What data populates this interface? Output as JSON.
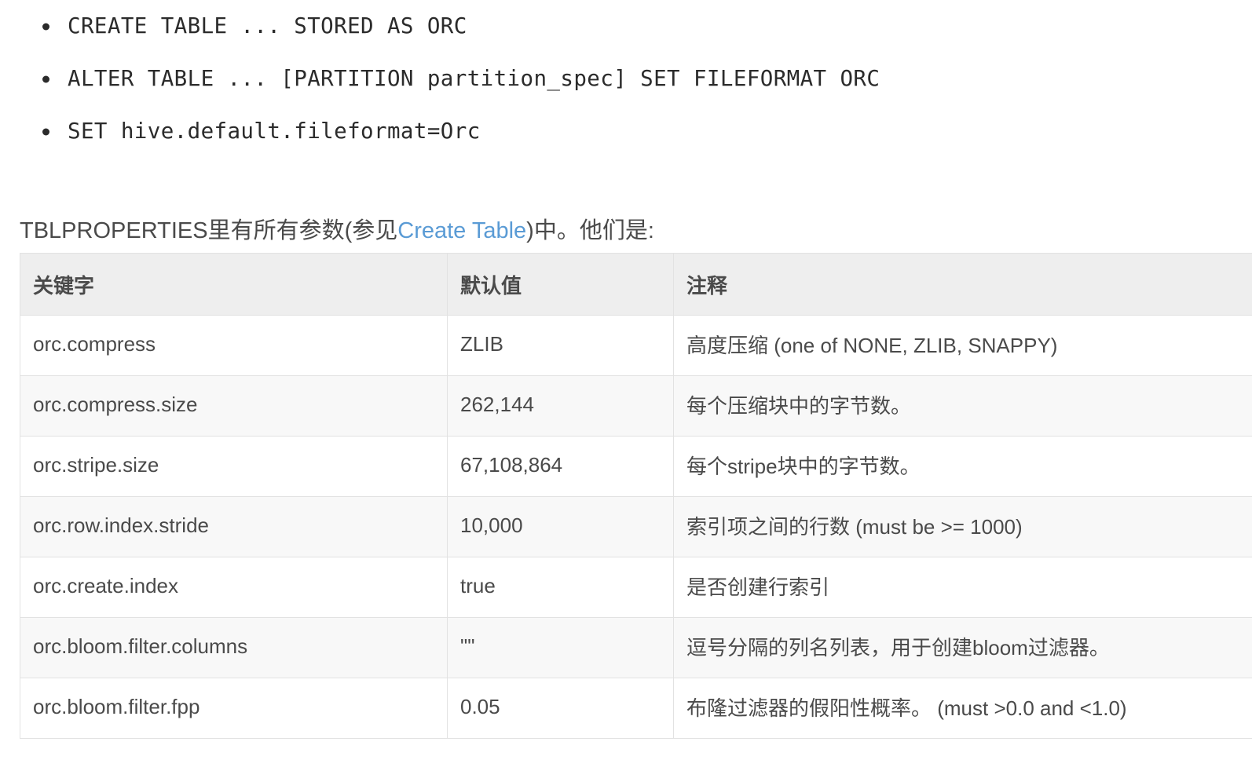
{
  "bullets": [
    {
      "text": "CREATE TABLE ... STORED AS ORC"
    },
    {
      "text": "ALTER TABLE ... [PARTITION partition_spec] SET FILEFORMAT ORC"
    },
    {
      "text": "SET hive.default.fileformat=Orc"
    }
  ],
  "paragraph": {
    "before_link": "TBLPROPERTIES里有所有参数(参见",
    "link_text": "Create Table",
    "after_link": ")中。他们是:"
  },
  "table": {
    "headers": [
      "关键字",
      "默认值",
      "注释"
    ],
    "rows": [
      {
        "key": "orc.compress",
        "default": "ZLIB",
        "note": "高度压缩 (one of NONE, ZLIB, SNAPPY)"
      },
      {
        "key": "orc.compress.size",
        "default": "262,144",
        "note": "每个压缩块中的字节数。"
      },
      {
        "key": "orc.stripe.size",
        "default": "67,108,864",
        "note": "每个stripe块中的字节数。"
      },
      {
        "key": "orc.row.index.stride",
        "default": "10,000",
        "note": "索引项之间的行数 (must be >= 1000)"
      },
      {
        "key": "orc.create.index",
        "default": "true",
        "note": "是否创建行索引"
      },
      {
        "key": "orc.bloom.filter.columns",
        "default": "\"\"",
        "note": "逗号分隔的列名列表，用于创建bloom过滤器。"
      },
      {
        "key": "orc.bloom.filter.fpp",
        "default": "0.05",
        "note": "布隆过滤器的假阳性概率。 (must >0.0 and <1.0)"
      }
    ]
  },
  "colors": {
    "link": "#5a9bd5",
    "header_bg": "#eeeeee",
    "stripe_bg": "#f8f8f8",
    "border": "#e2e2e2",
    "text": "#4a4a4a"
  }
}
